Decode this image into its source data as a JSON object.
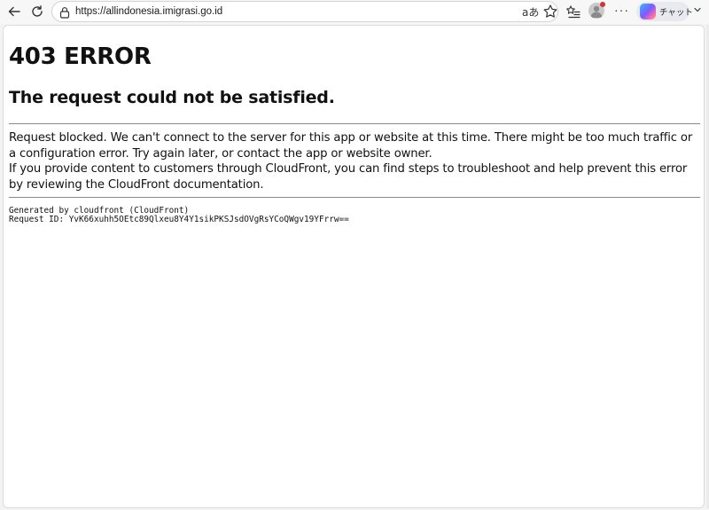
{
  "browser": {
    "url": "https://allindonesia.imigrasi.go.id",
    "read_aloud_glyph": "aあ",
    "more_label": "···",
    "chat_label": "チャット"
  },
  "page": {
    "title": "403 ERROR",
    "subtitle": "The request could not be satisfied.",
    "paragraph1": "Request blocked. We can't connect to the server for this app or website at this time. There might be too much traffic or a configuration error. Try again later, or contact the app or website owner.",
    "paragraph2": "If you provide content to customers through CloudFront, you can find steps to troubleshoot and help prevent this error by reviewing the CloudFront documentation.",
    "generated_by": "Generated by cloudfront (CloudFront)",
    "request_id": "Request ID: YvK66xuhh5OEtc89Qlxeu8Y4Y1sikPKSJsdOVgRsYCoQWgv19YFrrw=="
  }
}
